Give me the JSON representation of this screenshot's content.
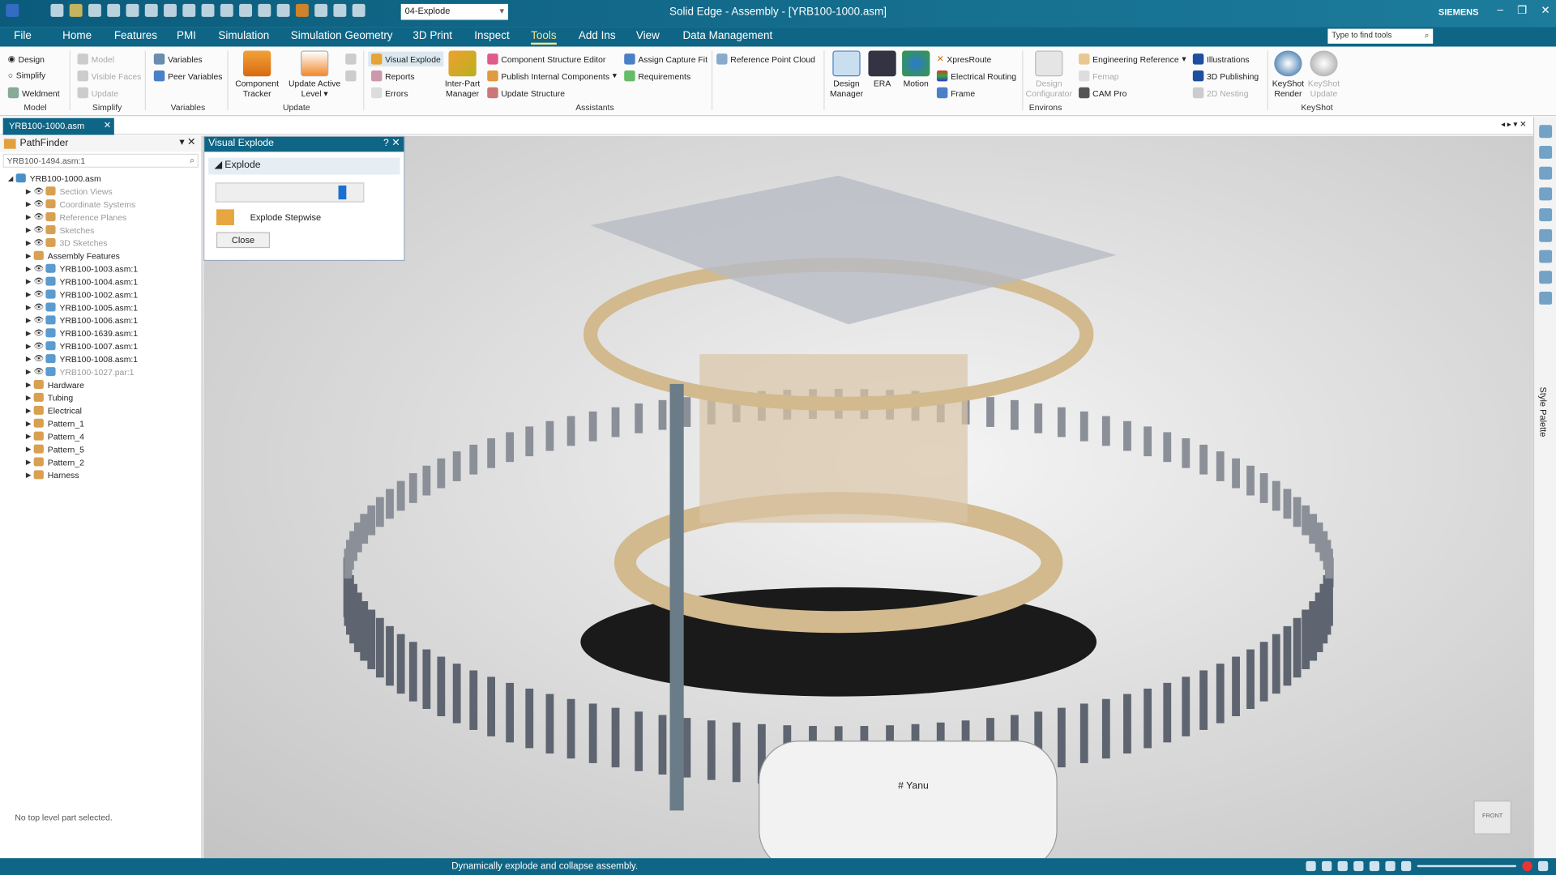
{
  "titlebar": {
    "title": "Solid Edge - Assembly - [YRB100-1000.asm]",
    "brand": "SIEMENS",
    "config_combo": "04-Explode",
    "minimize": "–",
    "restore": "❐",
    "close": "✕"
  },
  "menu": {
    "tabs": [
      "File",
      "Home",
      "Features",
      "PMI",
      "Simulation",
      "Simulation Geometry",
      "3D Print",
      "Inspect",
      "Tools",
      "Add Ins",
      "View",
      "Data Management"
    ],
    "active": "Tools",
    "search_placeholder": "Type to find tools"
  },
  "ribbon": {
    "model": {
      "items": [
        "Design",
        "Simplify",
        "Weldment"
      ],
      "label": "Model"
    },
    "simplify": {
      "items": [
        "Model",
        "Visible Faces",
        "Update"
      ],
      "label": "Simplify"
    },
    "variables": {
      "items": [
        "Variables",
        "Peer Variables"
      ],
      "label": "Variables"
    },
    "update": {
      "component_tracker": "Component Tracker",
      "update_active_level": "Update Active Level ▾",
      "label": "Update"
    },
    "assistants": {
      "visual_explode": "Visual Explode",
      "reports": "Reports",
      "errors": "Errors",
      "inter_part_manager": "Inter-Part Manager",
      "component_structure_editor": "Component Structure Editor",
      "publish_internal_components": "Publish Internal Components",
      "update_structure": "Update Structure",
      "assign_capture_fit": "Assign Capture Fit",
      "requirements": "Requirements",
      "reference_point_cloud": "Reference Point Cloud",
      "label": "Assistants"
    },
    "environs": {
      "design_manager": "Design Manager",
      "era": "ERA",
      "motion": "Motion",
      "xpresroute": "XpresRoute",
      "electrical_routing": "Electrical Routing",
      "frame": "Frame",
      "design_configurator": "Design Configurator",
      "engineering_reference": "Engineering Reference",
      "femap": "Femap",
      "cam_pro": "CAM Pro",
      "illustrations": "Illustrations",
      "publishing_3d": "3D Publishing",
      "nesting_2d": "2D Nesting",
      "label": "Environs"
    },
    "keyshot": {
      "render": "KeyShot Render",
      "update": "KeyShot Update",
      "label": "KeyShot"
    }
  },
  "doc_tab": "YRB100-1000.asm",
  "pathfinder": {
    "title": "PathFinder",
    "search_value": "YRB100-1494.asm:1",
    "footer": "No top level part selected.",
    "tree": [
      {
        "label": "YRB100-1000.asm",
        "level": 0
      },
      {
        "label": "Section Views",
        "level": 1,
        "gray": true
      },
      {
        "label": "Coordinate Systems",
        "level": 1,
        "gray": true
      },
      {
        "label": "Reference Planes",
        "level": 1,
        "gray": true
      },
      {
        "label": "Sketches",
        "level": 1,
        "gray": true
      },
      {
        "label": "3D Sketches",
        "level": 1,
        "gray": true
      },
      {
        "label": "Assembly Features",
        "level": 1
      },
      {
        "label": "YRB100-1003.asm:1",
        "level": 2
      },
      {
        "label": "YRB100-1004.asm:1",
        "level": 2
      },
      {
        "label": "YRB100-1002.asm:1",
        "level": 2
      },
      {
        "label": "YRB100-1005.asm:1",
        "level": 2
      },
      {
        "label": "YRB100-1006.asm:1",
        "level": 2
      },
      {
        "label": "YRB100-1639.asm:1",
        "level": 2
      },
      {
        "label": "YRB100-1007.asm:1",
        "level": 2
      },
      {
        "label": "YRB100-1008.asm:1",
        "level": 2
      },
      {
        "label": "YRB100-1027.par:1",
        "level": 2,
        "gray": true
      },
      {
        "label": "Hardware",
        "level": 1
      },
      {
        "label": "Tubing",
        "level": 1
      },
      {
        "label": "Electrical",
        "level": 1
      },
      {
        "label": "Pattern_1",
        "level": 1
      },
      {
        "label": "Pattern_4",
        "level": 1
      },
      {
        "label": "Pattern_5",
        "level": 1
      },
      {
        "label": "Pattern_2",
        "level": 1
      },
      {
        "label": "Harness",
        "level": 1
      }
    ]
  },
  "visual_explode": {
    "title": "Visual Explode",
    "help": "?",
    "section": "Explode",
    "slider_value": 0.9,
    "stepwise": "Explode Stepwise",
    "close": "Close"
  },
  "right_panel": {
    "style_palette": "Style Palette"
  },
  "viewport": {
    "label_qr": "# Yanu",
    "view_cube": "FRONT"
  },
  "status": {
    "message": "Dynamically explode and collapse assembly."
  }
}
